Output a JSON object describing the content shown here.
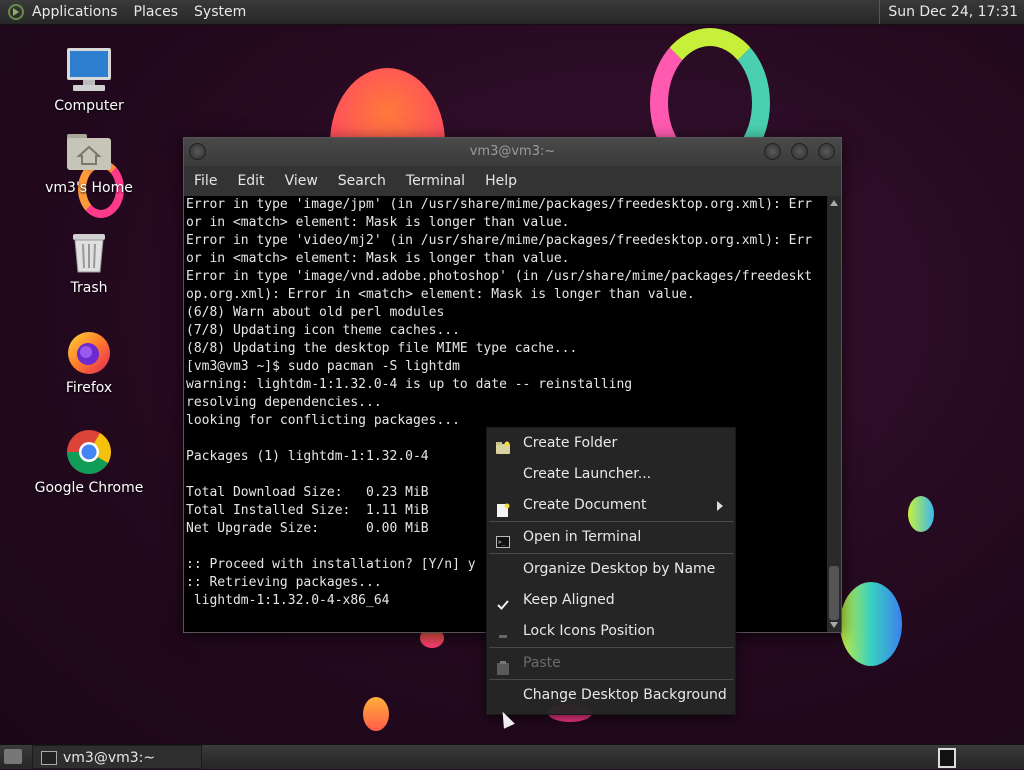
{
  "top_panel": {
    "menus": [
      "Applications",
      "Places",
      "System"
    ],
    "clock": "Sun Dec 24, 17:31"
  },
  "desktop_icons": [
    {
      "label": "Computer",
      "icon": "computer-icon"
    },
    {
      "label": "vm3's Home",
      "icon": "home-folder-icon"
    },
    {
      "label": "Trash",
      "icon": "trash-icon"
    },
    {
      "label": "Firefox",
      "icon": "firefox-icon"
    },
    {
      "label": "Google Chrome",
      "icon": "chrome-icon"
    }
  ],
  "terminal": {
    "title": "vm3@vm3:~",
    "menu": [
      "File",
      "Edit",
      "View",
      "Search",
      "Terminal",
      "Help"
    ],
    "lines": [
      "Error in type 'image/jpm' (in /usr/share/mime/packages/freedesktop.org.xml): Err",
      "or in <match> element: Mask is longer than value.",
      "Error in type 'video/mj2' (in /usr/share/mime/packages/freedesktop.org.xml): Err",
      "or in <match> element: Mask is longer than value.",
      "Error in type 'image/vnd.adobe.photoshop' (in /usr/share/mime/packages/freedeskt",
      "op.org.xml): Error in <match> element: Mask is longer than value.",
      "(6/8) Warn about old perl modules",
      "(7/8) Updating icon theme caches...",
      "(8/8) Updating the desktop file MIME type cache...",
      "[vm3@vm3 ~]$ sudo pacman -S lightdm",
      "warning: lightdm-1:1.32.0-4 is up to date -- reinstalling",
      "resolving dependencies...",
      "looking for conflicting packages...",
      "",
      "Packages (1) lightdm-1:1.32.0-4",
      "",
      "Total Download Size:   0.23 MiB",
      "Total Installed Size:  1.11 MiB",
      "Net Upgrade Size:      0.00 MiB",
      "",
      ":: Proceed with installation? [Y/n] y",
      ":: Retrieving packages...",
      " lightdm-1:1.32.0-4-x86_64"
    ]
  },
  "context_menu": {
    "items": [
      {
        "label": "Create Folder",
        "icon": "folder-icon",
        "disabled": false,
        "submenu": false
      },
      {
        "label": "Create Launcher...",
        "icon": "",
        "disabled": false,
        "submenu": false
      },
      {
        "label": "Create Document",
        "icon": "document-icon",
        "disabled": false,
        "submenu": true
      },
      {
        "separator": true
      },
      {
        "label": "Open in Terminal",
        "icon": "terminal-icon",
        "disabled": false,
        "submenu": false
      },
      {
        "separator": true
      },
      {
        "label": "Organize Desktop by Name",
        "icon": "",
        "disabled": false,
        "submenu": false
      },
      {
        "label": "Keep Aligned",
        "icon": "checkmark-icon",
        "disabled": false,
        "submenu": false
      },
      {
        "label": "Lock Icons Position",
        "icon": "dash-icon",
        "disabled": false,
        "submenu": false
      },
      {
        "separator": true
      },
      {
        "label": "Paste",
        "icon": "paste-icon",
        "disabled": true,
        "submenu": false
      },
      {
        "separator": true
      },
      {
        "label": "Change Desktop Background",
        "icon": "",
        "disabled": false,
        "submenu": false
      }
    ]
  },
  "bottom_panel": {
    "task_label": "vm3@vm3:~"
  },
  "colors": {
    "wallpaper": "#24091f",
    "panel": "#303030",
    "menu_bg": "#262626",
    "terminal_bg": "#000000"
  }
}
